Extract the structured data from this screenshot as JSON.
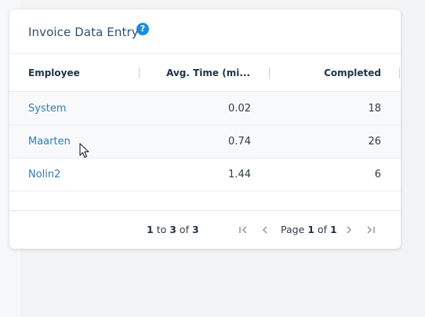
{
  "card": {
    "title": "Invoice Data Entry",
    "help_icon": "?"
  },
  "table": {
    "columns": [
      "Employee",
      "Avg. Time (mi...",
      "Completed"
    ],
    "rows": [
      {
        "employee": "System",
        "avg_time": "0.02",
        "completed": "18"
      },
      {
        "employee": "Maarten",
        "avg_time": "0.74",
        "completed": "26"
      },
      {
        "employee": "Nolin2",
        "avg_time": "1.44",
        "completed": "6"
      }
    ]
  },
  "pagination": {
    "range_start": "1",
    "to_label": "to",
    "range_end": "3",
    "of_label": "of",
    "total": "3",
    "page_label": "Page",
    "current_page": "1",
    "page_of_label": "of",
    "total_pages": "1",
    "first_icon": "first-page-icon",
    "prev_icon": "prev-page-icon",
    "next_icon": "next-page-icon",
    "last_icon": "last-page-icon"
  },
  "colors": {
    "accent": "#1e8ddc",
    "link": "#2e7db5",
    "title": "#2f4f6f"
  }
}
